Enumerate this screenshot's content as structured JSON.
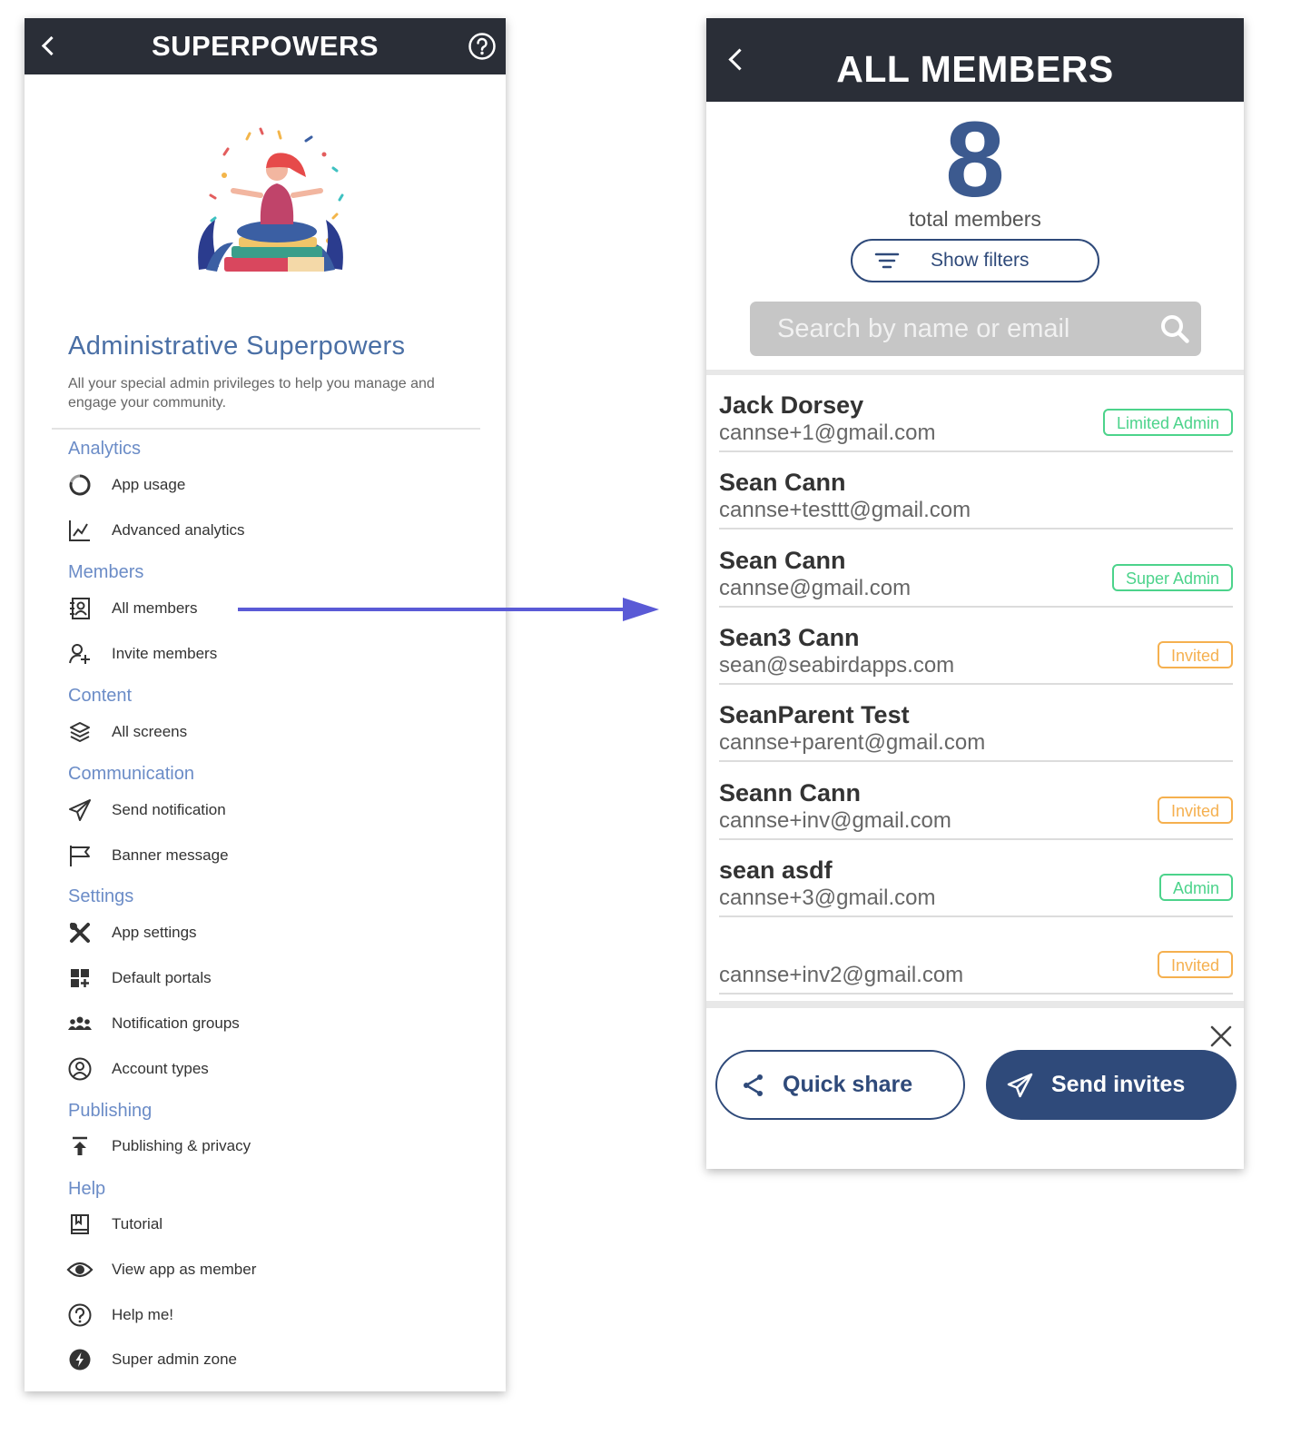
{
  "left_panel": {
    "title": "SUPERPOWERS",
    "heading": "Administrative Superpowers",
    "description": "All your special admin privileges to help you manage and engage your community.",
    "sections": {
      "analytics": "Analytics",
      "members": "Members",
      "content": "Content",
      "communication": "Communication",
      "settings": "Settings",
      "publishing": "Publishing",
      "help": "Help"
    },
    "items": {
      "app_usage": {
        "label": "App usage",
        "icon": "circle-progress-icon"
      },
      "advanced_analytics": {
        "label": "Advanced analytics",
        "icon": "chart-line-icon"
      },
      "all_members": {
        "label": "All members",
        "icon": "contact-card-icon"
      },
      "invite_members": {
        "label": "Invite members",
        "icon": "user-plus-icon"
      },
      "all_screens": {
        "label": "All screens",
        "icon": "layers-icon"
      },
      "send_notification": {
        "label": "Send notification",
        "icon": "paper-plane-icon"
      },
      "banner_message": {
        "label": "Banner message",
        "icon": "flag-icon"
      },
      "app_settings": {
        "label": "App settings",
        "icon": "tools-icon"
      },
      "default_portals": {
        "label": "Default portals",
        "icon": "grid-plus-icon"
      },
      "notification_groups": {
        "label": "Notification groups",
        "icon": "group-icon"
      },
      "account_types": {
        "label": "Account types",
        "icon": "user-circle-icon"
      },
      "publishing_privacy": {
        "label": "Publishing & privacy",
        "icon": "upload-icon"
      },
      "tutorial": {
        "label": "Tutorial",
        "icon": "book-icon"
      },
      "view_app_as_member": {
        "label": "View app as member",
        "icon": "eye-icon"
      },
      "help_me": {
        "label": "Help me!",
        "icon": "question-circle-icon"
      },
      "super_admin_zone": {
        "label": "Super admin zone",
        "icon": "bolt-circle-icon"
      }
    }
  },
  "right_panel": {
    "title": "ALL MEMBERS",
    "total": "8",
    "total_label": "total members",
    "filters_label": "Show filters",
    "search_placeholder": "Search by name or email",
    "members": [
      {
        "name": "Jack Dorsey",
        "email": "cannse+1@gmail.com",
        "badge": "Limited Admin",
        "badge_color": "#4cd38b"
      },
      {
        "name": "Sean Cann",
        "email": "cannse+testtt@gmail.com",
        "badge": "",
        "badge_color": ""
      },
      {
        "name": "Sean Cann",
        "email": "cannse@gmail.com",
        "badge": "Super Admin",
        "badge_color": "#4cd38b"
      },
      {
        "name": "Sean3 Cann",
        "email": "sean@seabirdapps.com",
        "badge": "Invited",
        "badge_color": "#f5b04f"
      },
      {
        "name": "SeanParent Test",
        "email": "cannse+parent@gmail.com",
        "badge": "",
        "badge_color": ""
      },
      {
        "name": "Seann Cann",
        "email": "cannse+inv@gmail.com",
        "badge": "Invited",
        "badge_color": "#f5b04f"
      },
      {
        "name": "sean asdf",
        "email": "cannse+3@gmail.com",
        "badge": "Admin",
        "badge_color": "#4cd38b"
      },
      {
        "name": "",
        "email": "cannse+inv2@gmail.com",
        "badge": "Invited",
        "badge_color": "#f5b04f"
      }
    ],
    "quick_share_label": "Quick share",
    "send_invites_label": "Send invites"
  },
  "colors": {
    "header_bg": "#2a2e37",
    "accent_blue": "#2f4a7a",
    "section_blue": "#6b8cc7",
    "arrow": "#5a5ad6"
  }
}
